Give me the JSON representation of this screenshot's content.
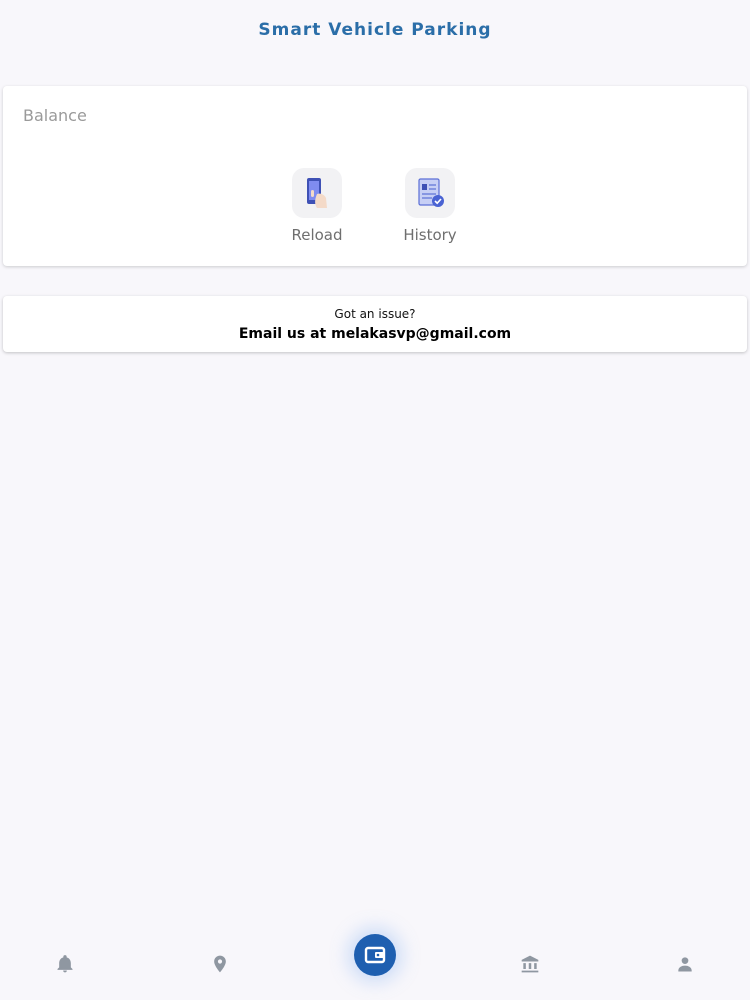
{
  "header": {
    "title": "Smart Vehicle Parking"
  },
  "balance_card": {
    "label": "Balance",
    "actions": [
      {
        "label": "Reload",
        "icon": "phone-reload-icon"
      },
      {
        "label": "History",
        "icon": "document-check-icon"
      }
    ]
  },
  "support_card": {
    "question": "Got an issue?",
    "email_text": "Email us at melakasvp@gmail.com"
  },
  "bottom_nav": {
    "items": [
      {
        "icon": "bell-icon"
      },
      {
        "icon": "location-pin-icon"
      },
      {
        "icon": "wallet-icon",
        "active": true
      },
      {
        "icon": "bank-icon"
      },
      {
        "icon": "person-icon"
      }
    ]
  },
  "colors": {
    "accent": "#2b6ea8",
    "nav_active": "#1e5fb0",
    "nav_inactive": "#8f97a1",
    "background": "#f8f7fb"
  }
}
